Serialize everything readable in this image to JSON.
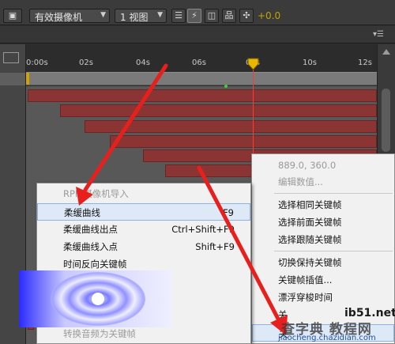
{
  "toolbar": {
    "camera_dropdown": "有效摄像机",
    "view_dropdown": "1 视图",
    "offset": "+0.0",
    "icons": [
      "grid-icon",
      "fast-preview-icon",
      "render-icon",
      "network-icon",
      "motion-blur-icon"
    ]
  },
  "timeline": {
    "ruler_ticks": [
      "0:00s",
      "02s",
      "04s",
      "06s",
      "08s",
      "10s",
      "12s"
    ],
    "layer_bar_color": "#8b3434",
    "playhead_color": "#ff3b2f",
    "work_area_color": "#7a7a7a"
  },
  "menu_left": {
    "items": [
      {
        "label": "RPF 摄像机导入",
        "shortcut": "",
        "disabled": true
      },
      {
        "label": "柔缓曲线",
        "shortcut": "F9",
        "highlighted": true
      },
      {
        "label": "柔缓曲线出点",
        "shortcut": "Ctrl+Shift+F9"
      },
      {
        "label": "柔缓曲线入点",
        "shortcut": "Shift+F9"
      },
      {
        "label": "时间反向关键帧",
        "shortcut": ""
      },
      {
        "label": "转换音频为关键帧",
        "shortcut": "",
        "disabled": true
      }
    ]
  },
  "menu_right": {
    "items": [
      {
        "label": "889.0, 360.0",
        "disabled": true
      },
      {
        "label": "编辑数值...",
        "disabled": true
      },
      {
        "label": "选择相同关键帧"
      },
      {
        "label": "选择前面关键帧"
      },
      {
        "label": "选择跟随关键帧"
      },
      {
        "label": "切换保持关键帧"
      },
      {
        "label": "关键帧插值..."
      },
      {
        "label": "漂浮穿梭时间"
      },
      {
        "label": "关"
      },
      {
        "label": "关"
      }
    ]
  },
  "watermark": {
    "site1": "ib51.net",
    "site2": "查字典 教程网",
    "site3": "jiaocheng.chazidian.com"
  }
}
